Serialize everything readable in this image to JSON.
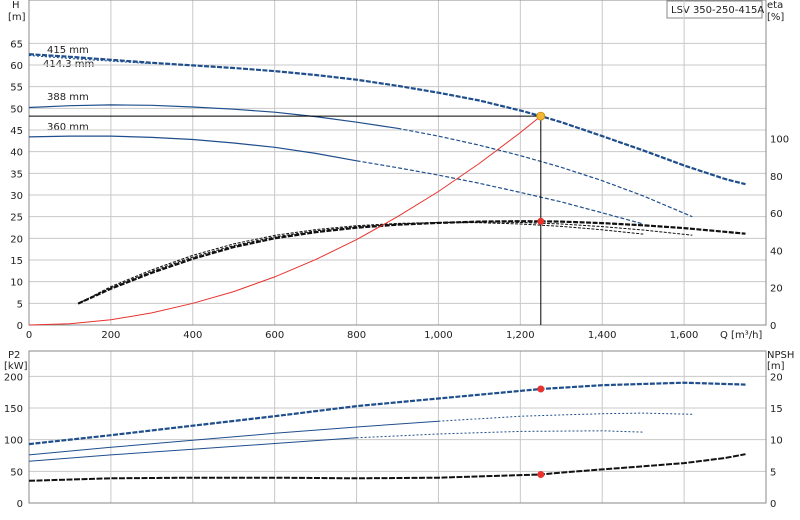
{
  "chart_data": [
    {
      "type": "line",
      "panel": "head-efficiency",
      "model_label": "LSV 350-250-415A",
      "xlabel": "Q [m³/h]",
      "ylabel": "H",
      "ylabel_unit": "[m]",
      "y2label": "eta",
      "y2label_unit": "[%]",
      "xlim": [
        0,
        1800
      ],
      "ylim": [
        0,
        75
      ],
      "y2lim": [
        0,
        174.4
      ],
      "x_ticks": [
        0,
        200,
        400,
        600,
        800,
        1000,
        1200,
        1400,
        1600
      ],
      "x_tick_labels": [
        "0",
        "200",
        "400",
        "600",
        "800",
        "1,000",
        "1,200",
        "1,400",
        "1,600"
      ],
      "y_ticks": [
        0,
        5,
        10,
        15,
        20,
        25,
        30,
        35,
        40,
        45,
        50,
        55,
        60,
        65
      ],
      "y2_ticks": [
        0,
        20,
        40,
        60,
        80,
        100
      ],
      "grid": true,
      "head_series": [
        {
          "name": "415 mm",
          "style": "bold-dashed",
          "x": [
            0,
            100,
            200,
            300,
            400,
            500,
            600,
            700,
            800,
            900,
            1000,
            1100,
            1200,
            1250,
            1300,
            1400,
            1500,
            1600,
            1700,
            1750
          ],
          "y": [
            62.5,
            61.9,
            61.2,
            60.5,
            59.9,
            59.3,
            58.6,
            57.7,
            56.6,
            55.2,
            53.6,
            51.8,
            49.5,
            48.2,
            46.8,
            43.6,
            40.3,
            36.8,
            33.7,
            32.5
          ]
        },
        {
          "name": "414.3 mm",
          "style": "thin",
          "x": [
            0,
            100,
            200,
            300
          ],
          "y": [
            62.2,
            61.5,
            60.9,
            60.3
          ]
        },
        {
          "name": "388 mm",
          "style": "solid-then-dashed",
          "x": [
            0,
            100,
            200,
            300,
            400,
            500,
            600,
            700,
            800,
            900,
            1000,
            1100,
            1200,
            1300,
            1400,
            1500,
            1620
          ],
          "y": [
            50.2,
            50.6,
            50.8,
            50.7,
            50.3,
            49.8,
            49.1,
            48.1,
            46.8,
            45.4,
            43.6,
            41.5,
            39.1,
            36.4,
            33.3,
            29.8,
            25.0
          ]
        },
        {
          "name": "360 mm",
          "style": "solid-then-dashed",
          "x": [
            0,
            100,
            200,
            300,
            400,
            500,
            600,
            700,
            800,
            900,
            1000,
            1100,
            1200,
            1300,
            1400,
            1500
          ],
          "y": [
            43.4,
            43.6,
            43.6,
            43.3,
            42.8,
            42.0,
            41.0,
            39.6,
            37.9,
            36.3,
            34.6,
            32.7,
            30.6,
            28.4,
            25.9,
            23.3
          ]
        }
      ],
      "system_curve": {
        "name": "",
        "x": [
          0,
          100,
          200,
          300,
          400,
          500,
          600,
          700,
          800,
          900,
          1000,
          1100,
          1200,
          1250
        ],
        "y": [
          0,
          0.3,
          1.2,
          2.8,
          5.0,
          7.7,
          11.1,
          15.1,
          19.7,
          25.0,
          30.8,
          37.3,
          44.4,
          48.2
        ]
      },
      "efficiency_series": [
        {
          "name": "",
          "style": "bold-dashed",
          "x": [
            120,
            200,
            300,
            400,
            500,
            600,
            700,
            800,
            900,
            1000,
            1100,
            1200,
            1300,
            1400,
            1500,
            1600,
            1700,
            1750
          ],
          "y": [
            11.5,
            19.5,
            28,
            35.5,
            41.8,
            46.5,
            49.8,
            52.2,
            53.8,
            54.8,
            55.5,
            55.7,
            55.5,
            54.7,
            53.5,
            52,
            50,
            49
          ]
        },
        {
          "name": "",
          "style": "thin",
          "x": [
            120,
            200,
            300,
            400,
            500,
            600,
            700,
            800,
            900,
            1000,
            1100,
            1200,
            1300,
            1400,
            1500,
            1620
          ],
          "y": [
            11.5,
            20,
            28.8,
            36.5,
            42.6,
            47.3,
            50.5,
            52.8,
            54.2,
            55,
            55.3,
            55,
            54.2,
            52.8,
            51,
            48.2
          ]
        },
        {
          "name": "",
          "style": "thin",
          "x": [
            120,
            200,
            300,
            400,
            500,
            600,
            700,
            800,
            900,
            1000,
            1100,
            1200,
            1300,
            1400,
            1500
          ],
          "y": [
            11.5,
            20.6,
            29.6,
            37.4,
            43.5,
            48.1,
            51.2,
            53.3,
            54.5,
            55,
            54.9,
            54.2,
            52.9,
            51.1,
            48.8
          ]
        }
      ],
      "operating_point": {
        "x": 1250,
        "head": 48.2,
        "efficiency": 55.6
      },
      "series_colors": {
        "head": "#1f4e8c",
        "efficiency": "#111111",
        "system": "#e8322e",
        "marker_head": "#f5b731",
        "marker_eff": "#e8322e"
      }
    },
    {
      "type": "line",
      "panel": "power-npsh",
      "ylabel": "P2",
      "ylabel_unit": "[kW]",
      "y2label": "NPSH",
      "y2label_unit": "[m]",
      "xlim": [
        0,
        1800
      ],
      "ylim": [
        0,
        240
      ],
      "y2lim": [
        0,
        24
      ],
      "y_ticks": [
        0,
        50,
        100,
        150,
        200
      ],
      "y2_ticks": [
        0,
        5,
        10,
        15,
        20
      ],
      "grid": true,
      "power_series": [
        {
          "name": "",
          "style": "bold-dashed",
          "x": [
            0,
            200,
            400,
            600,
            800,
            1000,
            1200,
            1250,
            1400,
            1600,
            1750
          ],
          "y": [
            93,
            107,
            122,
            137,
            153,
            165,
            177,
            180,
            186,
            190,
            187
          ]
        },
        {
          "name": "",
          "style": "thin",
          "x": [
            0,
            200,
            400,
            600,
            800,
            1000,
            1200,
            1400,
            1500,
            1620
          ],
          "y": [
            76,
            88,
            99,
            110,
            120,
            129,
            137,
            141,
            142,
            140
          ]
        },
        {
          "name": "",
          "style": "thin",
          "x": [
            0,
            200,
            400,
            600,
            800,
            1000,
            1200,
            1400,
            1500
          ],
          "y": [
            66,
            76,
            85,
            94,
            103,
            109,
            113,
            114,
            112
          ]
        }
      ],
      "npsh_series": [
        {
          "name": "",
          "x": [
            0,
            200,
            400,
            600,
            800,
            1000,
            1100,
            1200,
            1250,
            1300,
            1400,
            1500,
            1600,
            1700,
            1750
          ],
          "y": [
            3.5,
            3.9,
            4.0,
            4.0,
            3.9,
            4.0,
            4.2,
            4.4,
            4.5,
            4.8,
            5.3,
            5.8,
            6.3,
            7.1,
            7.7
          ]
        }
      ],
      "operating_point": {
        "x": 1250,
        "power": 180,
        "npsh": 4.5
      },
      "series_colors": {
        "power": "#1f4e8c",
        "npsh": "#111111",
        "marker": "#e8322e"
      }
    }
  ]
}
